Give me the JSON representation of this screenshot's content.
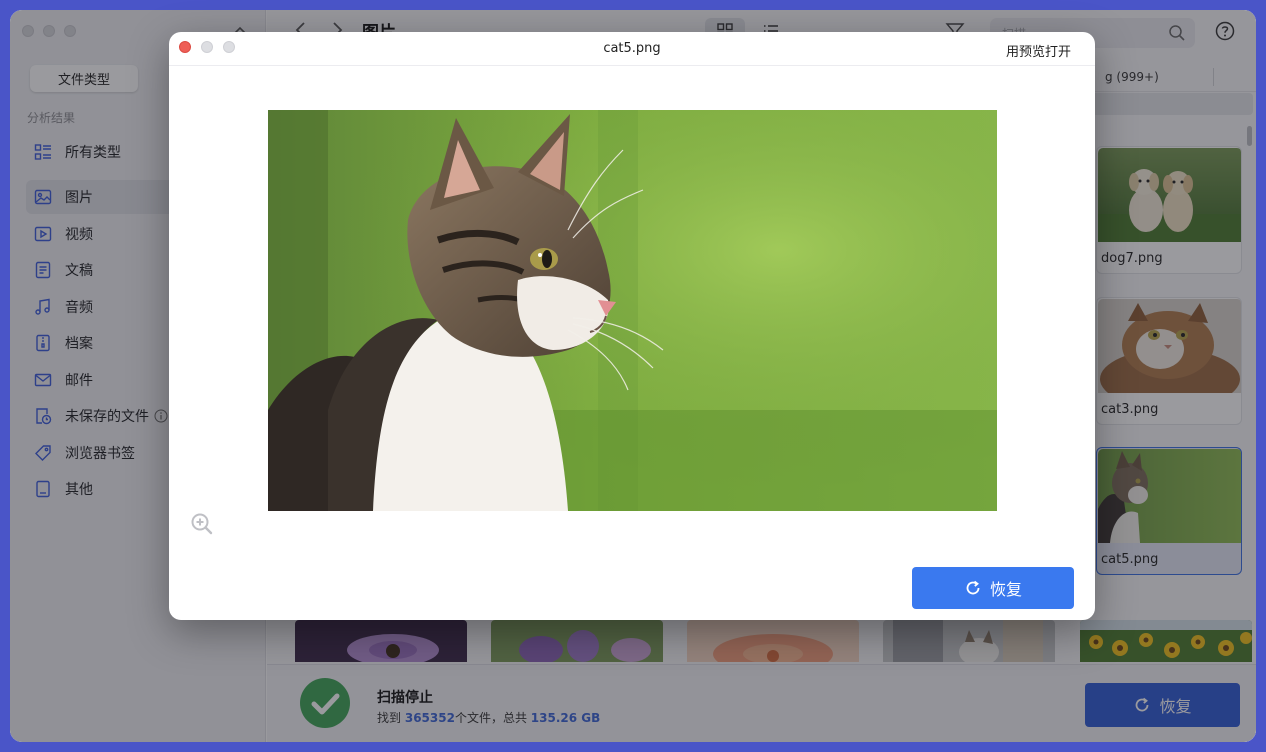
{
  "sidebar": {
    "tab_label": "文件类型",
    "section_label": "分析结果",
    "items": [
      {
        "label": "所有类型",
        "icon": "list-icon"
      },
      {
        "label": "图片",
        "icon": "image-icon"
      },
      {
        "label": "视频",
        "icon": "video-icon"
      },
      {
        "label": "文稿",
        "icon": "document-icon"
      },
      {
        "label": "音频",
        "icon": "music-icon"
      },
      {
        "label": "档案",
        "icon": "archive-icon"
      },
      {
        "label": "邮件",
        "icon": "mail-icon"
      },
      {
        "label": "未保存的文件",
        "icon": "unsaved-file-icon"
      },
      {
        "label": "浏览器书签",
        "icon": "bookmark-tag-icon"
      },
      {
        "label": "其他",
        "icon": "other-icon"
      }
    ]
  },
  "toolbar": {
    "title": "图片",
    "search_placeholder": "扫描"
  },
  "type_tabs": {
    "visible_label": "g (999+)"
  },
  "cards": [
    {
      "label": "dog7.png"
    },
    {
      "label": "cat3.png"
    },
    {
      "label": "cat5.png"
    }
  ],
  "footer": {
    "title": "扫描停止",
    "found_prefix": "找到",
    "file_count": "365352",
    "found_middle": "个文件，总共",
    "total_size": "135.26 GB",
    "recover_label": "恢复"
  },
  "modal": {
    "title": "cat5.png",
    "open_with_preview": "用预览打开",
    "recover_label": "恢复"
  },
  "colors": {
    "accent_blue": "#3a79ef",
    "footer_button": "#2f5bd6",
    "success_green": "#3fa556",
    "close_red": "#ee5f57",
    "desktop_bg": "#4a55c8"
  }
}
